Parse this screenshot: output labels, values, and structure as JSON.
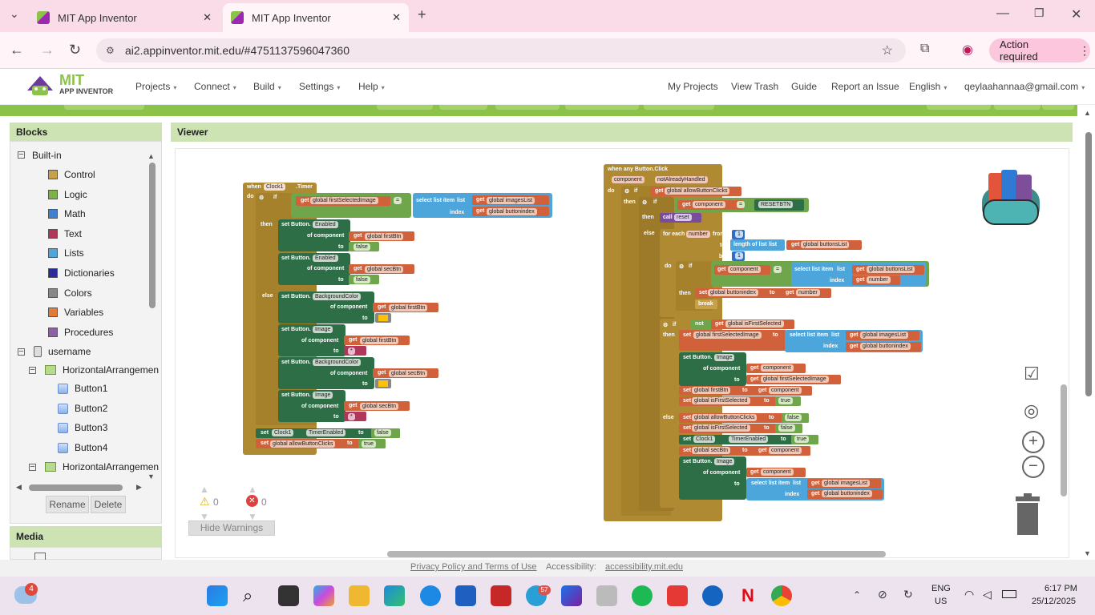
{
  "browser": {
    "tabs": [
      {
        "title": "MIT App Inventor",
        "active": false
      },
      {
        "title": "MIT App Inventor",
        "active": true
      }
    ],
    "url": "ai2.appinventor.mit.edu/#4751137596047360",
    "action_required": "Action required"
  },
  "app_header": {
    "logo_main": "MIT",
    "logo_sub": "APP INVENTOR",
    "menus": [
      "Projects",
      "Connect",
      "Build",
      "Settings",
      "Help"
    ],
    "right_links": [
      "My Projects",
      "View Trash",
      "Guide",
      "Report an Issue"
    ],
    "language": "English",
    "account": "qeylaahannaa@gmail.com"
  },
  "blocks_panel": {
    "title": "Blocks",
    "builtin_label": "Built-in",
    "builtin": [
      {
        "label": "Control",
        "color": "#c9a04a"
      },
      {
        "label": "Logic",
        "color": "#7cb342"
      },
      {
        "label": "Math",
        "color": "#3f7fd0"
      },
      {
        "label": "Text",
        "color": "#b0365a"
      },
      {
        "label": "Lists",
        "color": "#4da6db"
      },
      {
        "label": "Dictionaries",
        "color": "#2a2a9a"
      },
      {
        "label": "Colors",
        "color": "#888888"
      },
      {
        "label": "Variables",
        "color": "#e07b39"
      },
      {
        "label": "Procedures",
        "color": "#8d5fa8"
      }
    ],
    "screen_label": "username",
    "arrangement1": "HorizontalArrangemen",
    "buttons": [
      "Button1",
      "Button2",
      "Button3",
      "Button4"
    ],
    "arrangement2": "HorizontalArrangemen",
    "rename": "Rename",
    "delete": "Delete"
  },
  "media_panel": {
    "title": "Media"
  },
  "viewer": {
    "title": "Viewer",
    "warnings_count": "0",
    "errors_count": "0",
    "hide_warnings": "Hide Warnings"
  },
  "timer_block": {
    "when": "when",
    "component": "Clock1",
    "event": ".Timer",
    "do": "do",
    "if": "if",
    "get": "get",
    "var_first_selected_image": "global firstSelectedImage",
    "eq": "=",
    "select_list_item": "select list item",
    "list": "list",
    "index": "index",
    "images_list": "global imagesList",
    "button_index": "global buttonindex",
    "then": "then",
    "else": "else",
    "set_button": "set Button.",
    "enabled": "Enabled",
    "of_component": "of component",
    "to": "to",
    "first_btn": "global firstBtn",
    "sec_btn": "global secBtn",
    "false": "false",
    "true": "true",
    "background_color": "BackgroundColor",
    "image": "Image",
    "star": "* ",
    "set": "set",
    "timer_enabled": "TimerEnabled",
    "allow_clicks": "global allowButtonClicks"
  },
  "any_button_block": {
    "when": "when any Button.Click",
    "component": "component",
    "not_handled": "notAlreadyHandled",
    "do": "do",
    "if": "if",
    "then": "then",
    "else": "else",
    "get": "get",
    "allow_clicks": "global allowButtonClicks",
    "eq": "=",
    "resetbtn": "RESETBTN",
    "call": "call",
    "reset": "reset",
    "for_each": "for each",
    "number": "number",
    "from": "from",
    "length_of_list": "length of list",
    "list": "list",
    "buttons_list": "global buttonsList",
    "by": "by",
    "one": "1",
    "select_list_item": "select list item",
    "index": "index",
    "set": "set",
    "button_index": "global buttonindex",
    "to": "to",
    "break": "break",
    "not": "not",
    "is_first_selected": "global isFirstSelected",
    "first_selected_image": "global firstSelectedImage",
    "images_list": "global imagesList",
    "set_button": "set Button.",
    "image": "Image",
    "of_component": "of component",
    "first_btn": "global firstBtn",
    "true": "true",
    "false": "false",
    "clock": "Clock1",
    "timer_enabled": "TimerEnabled",
    "sec_btn": "global secBtn"
  },
  "footer": {
    "privacy": "Privacy Policy and Terms of Use",
    "accessibility_label": "Accessibility:",
    "accessibility_link": "accessibility.mit.edu"
  },
  "taskbar": {
    "weather_badge": "4",
    "teams_badge": "57",
    "lang_line1": "ENG",
    "lang_line2": "US",
    "time": "6:17 PM",
    "date": "25/12/2025"
  }
}
